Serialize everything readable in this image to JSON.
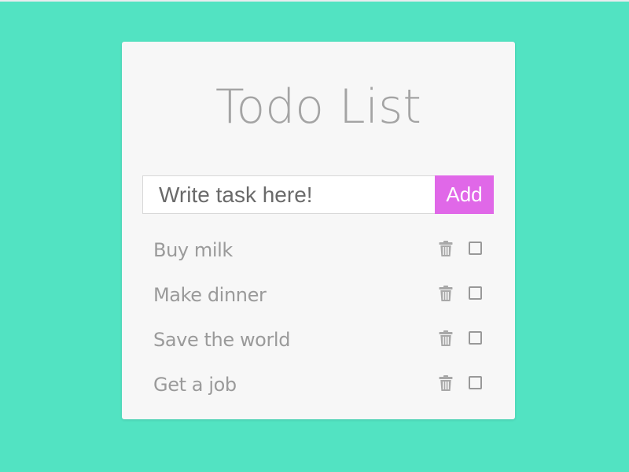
{
  "app": {
    "title": "Todo List"
  },
  "form": {
    "placeholder": "Write task here!",
    "add_label": "Add"
  },
  "tasks": [
    {
      "label": "Buy milk",
      "done": false
    },
    {
      "label": "Make dinner",
      "done": false
    },
    {
      "label": "Save the world",
      "done": false
    },
    {
      "label": "Get a job",
      "done": false
    }
  ],
  "icons": {
    "delete": "trash-icon",
    "complete": "checkbox"
  },
  "colors": {
    "background": "#52e3c2",
    "card": "#f7f7f7",
    "accent": "#e068e8",
    "text": "#9a9a9a"
  }
}
